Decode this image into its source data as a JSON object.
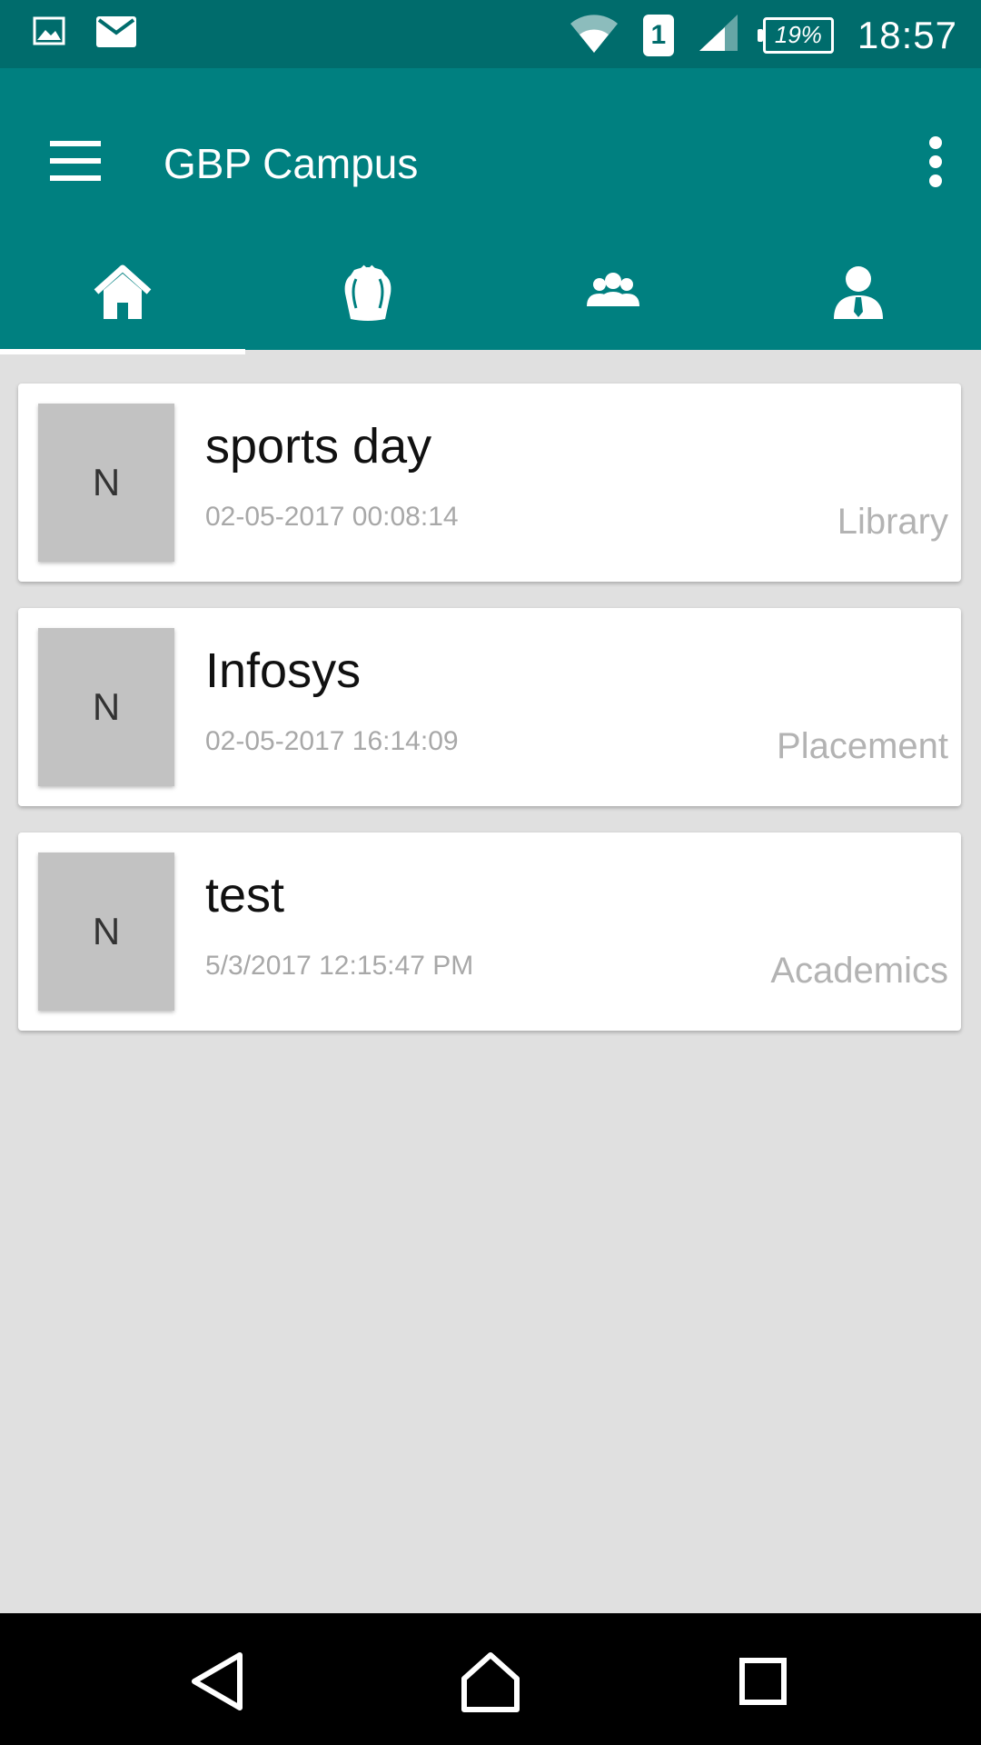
{
  "status_bar": {
    "time": "18:57",
    "battery": "19%",
    "sim_slot": "1",
    "icons": [
      "image-icon",
      "mail-icon",
      "wifi-icon",
      "sim-icon",
      "signal-icon",
      "battery-icon"
    ]
  },
  "app_bar": {
    "title": "GBP Campus",
    "background_color": "#008080",
    "menu_icon": "hamburger-icon",
    "overflow_icon": "more-vert-icon"
  },
  "tabs": [
    {
      "icon": "home-icon",
      "selected": true
    },
    {
      "icon": "backpack-icon",
      "selected": false
    },
    {
      "icon": "group-icon",
      "selected": false
    },
    {
      "icon": "person-tie-icon",
      "selected": false
    }
  ],
  "notices": [
    {
      "avatar_letter": "N",
      "title": "sports day",
      "date": "02-05-2017 00:08:14",
      "category": "Library"
    },
    {
      "avatar_letter": "N",
      "title": "Infosys",
      "date": "02-05-2017 16:14:09",
      "category": "Placement"
    },
    {
      "avatar_letter": "N",
      "title": "test",
      "date": "5/3/2017 12:15:47 PM",
      "category": "Academics"
    }
  ],
  "nav_bar": {
    "icons": [
      "back-icon",
      "home-icon",
      "recents-icon"
    ]
  }
}
